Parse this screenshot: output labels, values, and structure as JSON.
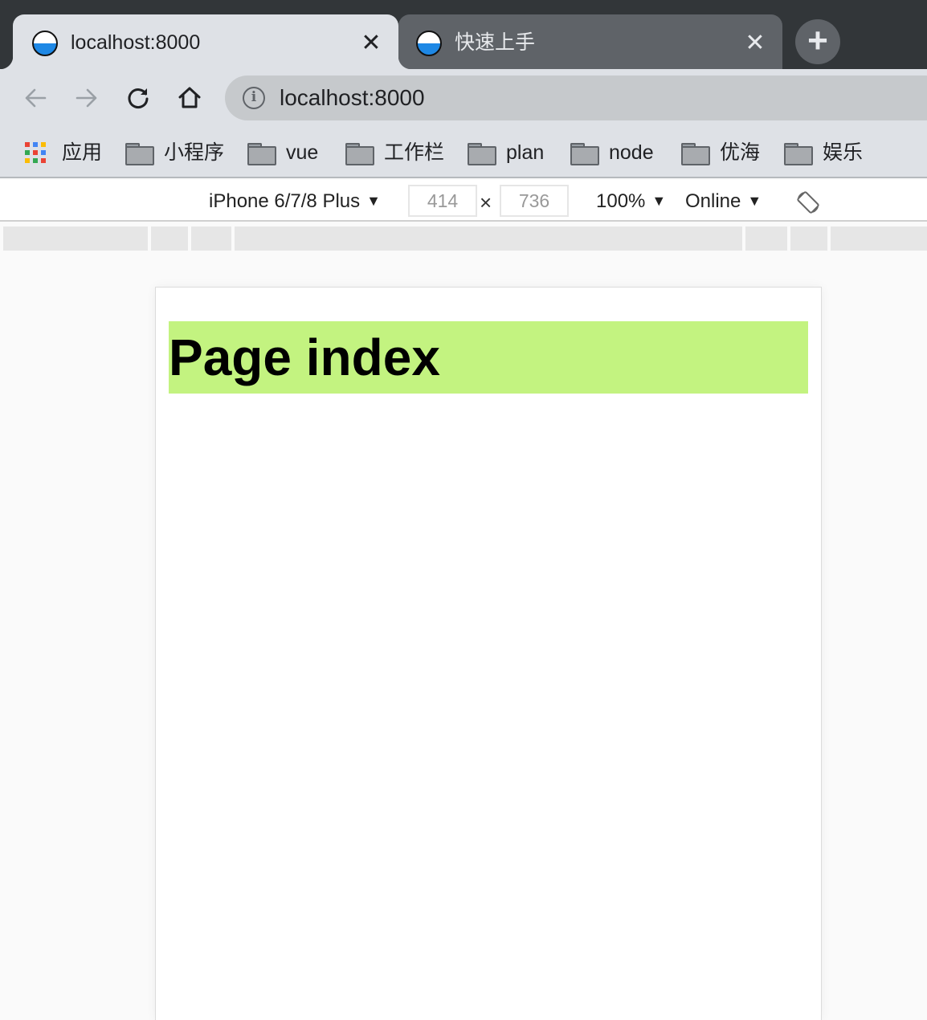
{
  "tabs": [
    {
      "title": "localhost:8000",
      "active": true
    },
    {
      "title": "快速上手",
      "active": false
    }
  ],
  "icons": {
    "tab_close": "close-icon",
    "new_tab": "plus-icon",
    "back": "arrow-left-icon",
    "forward": "arrow-right-icon",
    "reload": "reload-icon",
    "home": "home-icon",
    "site_info": "info-icon",
    "apps": "apps-grid-icon",
    "folder": "folder-icon",
    "rotate": "rotate-device-icon"
  },
  "tab_close_glyph": "✕",
  "new_tab_glyph": "+",
  "address_bar": {
    "info_glyph": "i",
    "url": "localhost:8000"
  },
  "bookmarks": {
    "apps_label": "应用",
    "folders": [
      "小程序",
      "vue",
      "工作栏",
      "plan",
      "node",
      "优海",
      "娱乐"
    ]
  },
  "device_toolbar": {
    "device": "iPhone 6/7/8 Plus",
    "width": "414",
    "height": "736",
    "times": "×",
    "zoom": "100%",
    "network": "Online",
    "caret": "▼"
  },
  "page": {
    "heading": "Page index",
    "heading_bg": "#c3f380"
  },
  "colors": {
    "tabstrip_bg": "#323639",
    "active_tab_bg": "#dee1e6",
    "inactive_tab_bg": "#5f6368",
    "omnibox_bg": "#c6c9cc",
    "favicon_blue": "#1e88e5"
  }
}
